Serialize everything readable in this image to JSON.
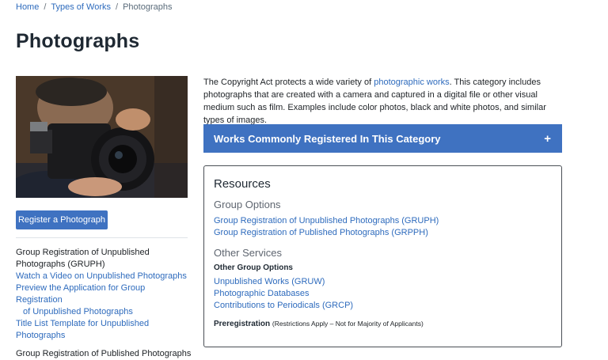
{
  "breadcrumb": {
    "home": "Home",
    "types": "Types of Works",
    "current": "Photographs",
    "sep": "/"
  },
  "page": {
    "title": "Photographs"
  },
  "left": {
    "register_button": "Register a Photograph",
    "links": [
      {
        "line1": "Group Registration of Unpublished",
        "line2": "Photographs (GRUPH)"
      },
      {
        "text": "Watch a Video on Unpublished Photographs"
      },
      {
        "line1": "Preview the Application for Group Registration",
        "line2": "of Unpublished Photographs"
      },
      {
        "text": "Title List Template for Unpublished Photographs"
      },
      {
        "text": "Group Registration of Published Photographs"
      }
    ]
  },
  "intro": {
    "before": "The Copyright Act protects a wide variety of ",
    "link": "photographic works",
    "after": ". This category includes photographs that are created with a camera and captured in a digital file or other visual medium such as film. Examples include color photos, black and white photos, and similar types of images."
  },
  "accordion": {
    "label": "Works Commonly Registered In This Category",
    "icon": "+"
  },
  "resources": {
    "title": "Resources",
    "group_options": {
      "heading": "Group Options",
      "links": [
        "Group Registration of Unpublished Photographs (GRUPH)",
        "Group Registration of Published Photographs (GRPPH)"
      ]
    },
    "other_services": {
      "heading": "Other Services",
      "subheading": "Other Group Options",
      "links": [
        "Unpublished Works (GRUW)",
        "Photographic Databases",
        "Contributions to Periodicals (GRCP)"
      ]
    },
    "preregistration": {
      "label": "Preregistration",
      "note": "(Restrictions Apply – Not for Majority of Applicants)"
    }
  },
  "colors": {
    "accent": "#3f72c1",
    "link": "#2e6bbd"
  }
}
